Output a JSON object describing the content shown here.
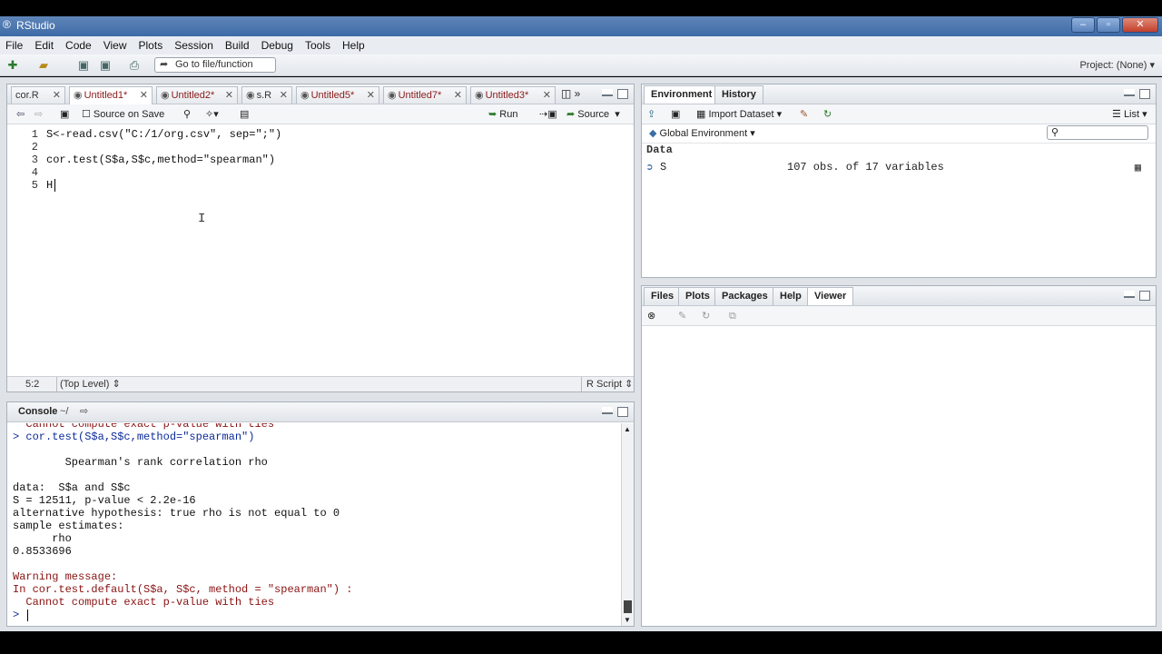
{
  "window": {
    "title": "RStudio"
  },
  "menu": [
    "File",
    "Edit",
    "Code",
    "View",
    "Plots",
    "Session",
    "Build",
    "Debug",
    "Tools",
    "Help"
  ],
  "toolbar": {
    "goto_placeholder": "Go to file/function",
    "project": "Project: (None)"
  },
  "source": {
    "tabs": [
      {
        "label": "cor.R",
        "unsaved": false
      },
      {
        "label": "Untitled1*",
        "unsaved": true
      },
      {
        "label": "Untitled2*",
        "unsaved": true
      },
      {
        "label": "s.R",
        "unsaved": false
      },
      {
        "label": "Untitled5*",
        "unsaved": true
      },
      {
        "label": "Untitled7*",
        "unsaved": true
      },
      {
        "label": "Untitled3*",
        "unsaved": true
      }
    ],
    "source_on_save": "Source on Save",
    "run": "Run",
    "source_btn": "Source",
    "lines": [
      {
        "n": "1",
        "code": "S<-read.csv(\"C:/1/org.csv\", sep=\";\")"
      },
      {
        "n": "2",
        "code": ""
      },
      {
        "n": "3",
        "code": "cor.test(S$a,S$c,method=\"spearman\")"
      },
      {
        "n": "4",
        "code": ""
      },
      {
        "n": "5",
        "code": "H"
      }
    ],
    "status_pos": "5:2",
    "status_level": "(Top Level)",
    "status_type": "R Script"
  },
  "console": {
    "title": "Console",
    "path": "~/",
    "lines": [
      {
        "text": "  Cannot compute exact p-value with ties",
        "style": "red"
      },
      {
        "text": "> cor.test(S$a,S$c,method=\"spearman\")",
        "style": "blue"
      },
      {
        "text": "",
        "style": ""
      },
      {
        "text": "        Spearman's rank correlation rho",
        "style": ""
      },
      {
        "text": "",
        "style": ""
      },
      {
        "text": "data:  S$a and S$c",
        "style": ""
      },
      {
        "text": "S = 12511, p-value < 2.2e-16",
        "style": ""
      },
      {
        "text": "alternative hypothesis: true rho is not equal to 0",
        "style": ""
      },
      {
        "text": "sample estimates:",
        "style": ""
      },
      {
        "text": "      rho",
        "style": ""
      },
      {
        "text": "0.8533696",
        "style": ""
      },
      {
        "text": "",
        "style": ""
      },
      {
        "text": "Warning message:",
        "style": "red"
      },
      {
        "text": "In cor.test.default(S$a, S$c, method = \"spearman\") :",
        "style": "red"
      },
      {
        "text": "  Cannot compute exact p-value with ties",
        "style": "red"
      },
      {
        "text": "> ",
        "style": "blue"
      }
    ]
  },
  "environment": {
    "tabs": [
      "Environment",
      "History"
    ],
    "import_dataset": "Import Dataset",
    "list": "List",
    "scope": "Global Environment",
    "section": "Data",
    "rows": [
      {
        "name": "S",
        "value": "107 obs. of 17 variables"
      }
    ]
  },
  "files": {
    "tabs": [
      "Files",
      "Plots",
      "Packages",
      "Help",
      "Viewer"
    ],
    "active": "Viewer"
  }
}
